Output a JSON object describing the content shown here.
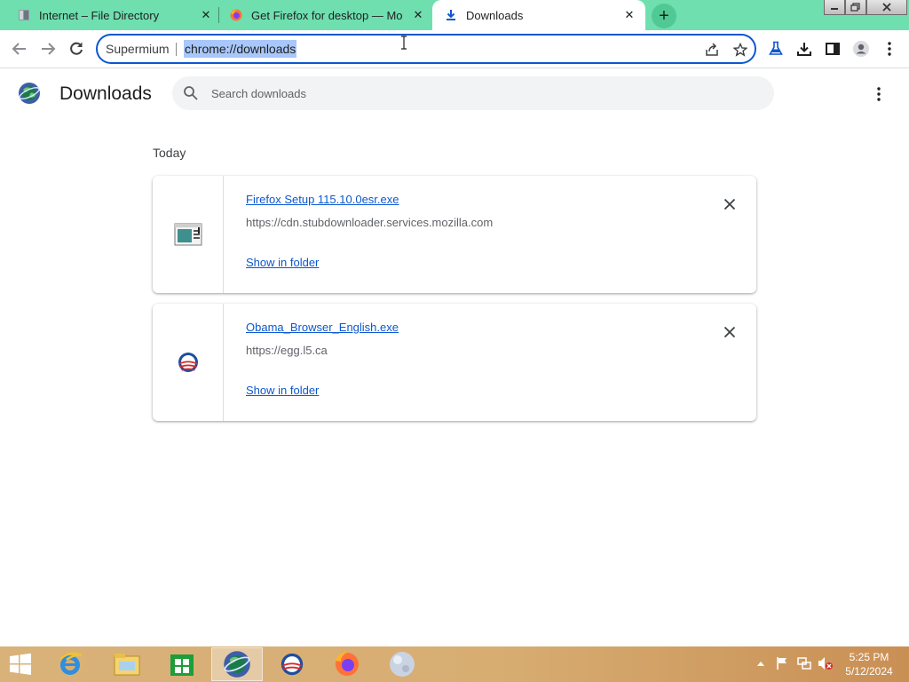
{
  "tabs": [
    {
      "title": "Internet – File Directory",
      "icon": "file-directory-icon",
      "active": false
    },
    {
      "title": "Get Firefox for desktop — Mozilla",
      "icon": "firefox-icon",
      "active": false
    },
    {
      "title": "Downloads",
      "icon": "download-arrow-icon",
      "active": true
    }
  ],
  "omnibox": {
    "origin": "Supermium",
    "url": "chrome://downloads"
  },
  "page": {
    "title": "Downloads",
    "search_placeholder": "Search downloads",
    "section_label": "Today"
  },
  "downloads": [
    {
      "file_name": "Firefox Setup 115.10.0esr.exe",
      "url": "https://cdn.stubdownloader.services.mozilla.com",
      "action_label": "Show in folder",
      "icon": "installer-window-icon"
    },
    {
      "file_name": "Obama_Browser_English.exe",
      "url": "https://egg.l5.ca",
      "action_label": "Show in folder",
      "icon": "obama-logo-icon"
    }
  ],
  "taskbar": {
    "apps": [
      "internet-explorer-icon",
      "file-explorer-icon",
      "store-icon",
      "supermium-browser-icon",
      "obama-browser-icon",
      "firefox-icon",
      "moon-globe-icon"
    ],
    "clock": {
      "time": "5:25 PM",
      "date": "5/12/2024"
    }
  },
  "colors": {
    "tabstrip": "#6fdfb0",
    "accent": "#0b57d0",
    "url_selection": "#a8c7fa",
    "taskbar": "#d7ad72"
  }
}
